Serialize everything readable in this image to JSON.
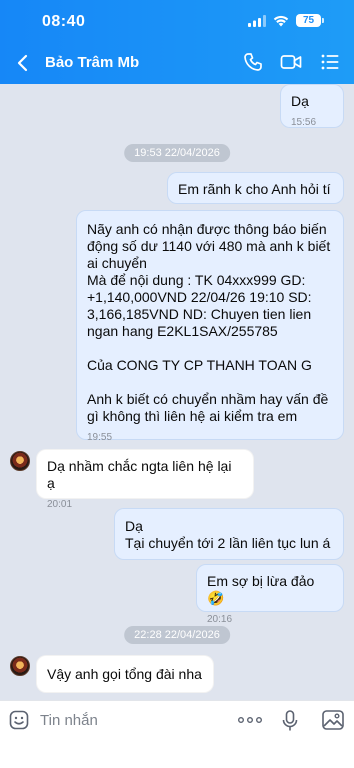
{
  "status_bar": {
    "time": "08:40",
    "battery": "75"
  },
  "header": {
    "contact_name": "Bảo Trâm Mb"
  },
  "messages": [
    {
      "text": "Dạ",
      "time": "15:56"
    },
    {
      "date_chip": "19:53 22/04/2026"
    },
    {
      "text": "Em rãnh k cho Anh hỏi tí"
    },
    {
      "text": "Nãy anh có nhận được thông báo biến động số dư 1140 với 480 mà anh k biết ai chuyển\nMà để nội dung : TK 04xxx999 GD: +1,140,000VND 22/04/26 19:10  SD: 3,166,185VND ND: Chuyen tien lien ngan hang E2KL1SAX/255785\n\nCủa CONG TY CP THANH TOAN G\n\nAnh k biết có chuyển nhầm hay vấn đề gì không thì liên hệ ai kiểm tra em",
      "time": "19:55"
    },
    {
      "text": "Dạ nhầm chắc ngta liên hệ lại ạ",
      "time": "20:01"
    },
    {
      "text": "Dạ\nTại chuyển tới 2 lần liên tục lun á"
    },
    {
      "text": "Em sợ bị lừa đảo 🤣",
      "time": "20:16"
    },
    {
      "date_chip": "22:28 22/04/2026"
    },
    {
      "text": "Vậy anh gọi tổng đài nha"
    }
  ],
  "input_bar": {
    "placeholder": "Tin nhắn"
  },
  "icons": {
    "back": "chevron-left-icon",
    "call": "phone-icon",
    "video": "video-camera-icon",
    "menu": "list-menu-icon",
    "sticker": "smiley-icon",
    "more": "more-dots-icon",
    "mic": "microphone-icon",
    "image": "image-icon"
  },
  "colors": {
    "header": "#1687f7",
    "chat_background": "#dfe4ee",
    "my_bubble": "#e5efff",
    "their_bubble": "#ffffff",
    "date_chip": "#bfc6d1"
  }
}
